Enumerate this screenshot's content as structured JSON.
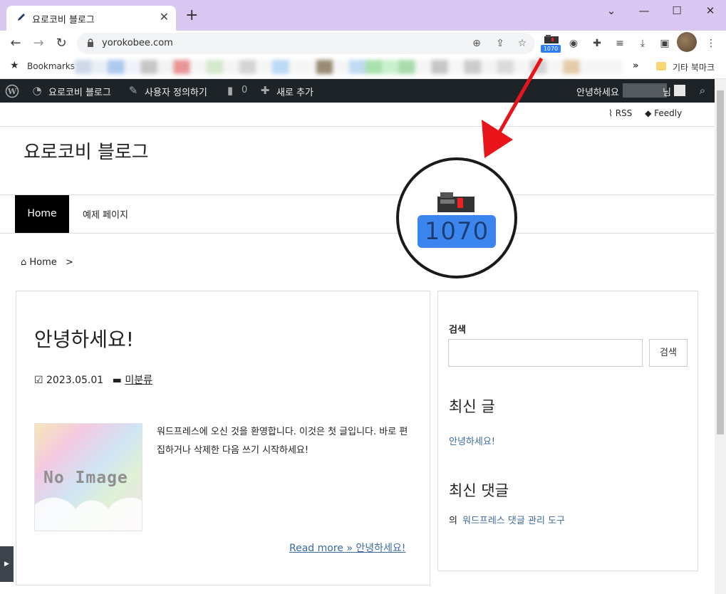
{
  "browser": {
    "tab_title": "요로코비 블로그",
    "tab_close": "✕",
    "new_tab": "+",
    "window_controls": [
      "⌄",
      "—",
      "☐",
      "✕"
    ],
    "url": "yorokobee.com",
    "extension_badge": "1070",
    "bookmarks_label": "Bookmarks",
    "bookmarks_more": "»",
    "other_bookmarks": "기타 북마크"
  },
  "adminbar": {
    "site_name": "요로코비 블로그",
    "customize": "사용자 정의하기",
    "comments_count": "0",
    "new": "새로 추가",
    "greeting": "안녕하세요",
    "greeting_suffix": "님"
  },
  "site": {
    "top_links": {
      "rss": "RSS",
      "feedly": "Feedly"
    },
    "title": "요로코비 블로그",
    "nav": {
      "home": "Home",
      "sample": "예제 페이지"
    },
    "breadcrumb": {
      "home": "Home",
      "sep": ">"
    }
  },
  "post": {
    "title": "안녕하세요!",
    "date": "2023.05.01",
    "category": "미분류",
    "thumbnail_text": "No Image",
    "excerpt": "워드프레스에 오신 것을 환영합니다. 이것은 첫 글입니다. 바로 편집하거나 삭제한 다음 쓰기 시작하세요!",
    "read_more": "Read more »  안녕하세요!"
  },
  "sidebar": {
    "search_title": "검색",
    "search_button": "검색",
    "search_value": "",
    "recent_posts_title": "최신 글",
    "recent_post": "안녕하세요!",
    "recent_comments_title": "최신 댓글",
    "comment_prefix": "의",
    "comment_link": "워드프레스 댓글 관리 도구"
  },
  "annotation": {
    "magnified_badge": "1070",
    "arrow_color": "#e8141a",
    "circle_color": "#1a1a1a"
  },
  "colors": {
    "tab_strip": "#d9c7f2",
    "admin_bar": "#1d2327",
    "link": "#3b6aa0",
    "nav_active": "#000000",
    "badge": "#2e7cf6"
  }
}
